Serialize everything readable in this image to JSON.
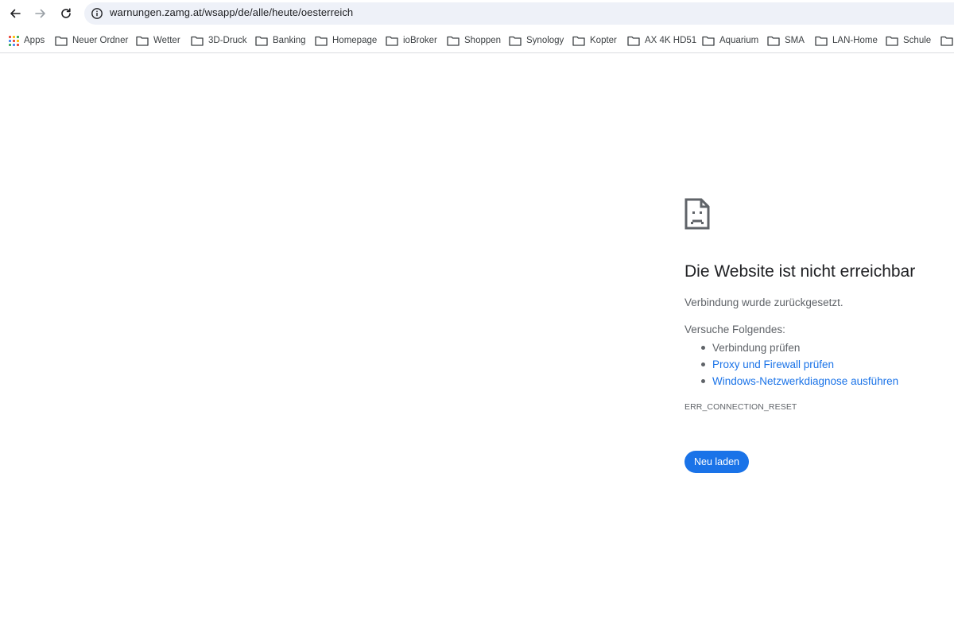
{
  "toolbar": {
    "url": "warnungen.zamg.at/wsapp/de/alle/heute/oesterreich",
    "icons": [
      "back-icon",
      "forward-icon",
      "reload-icon",
      "site-info-icon"
    ]
  },
  "bookmarks": {
    "apps_label": "Apps",
    "items": [
      {
        "label": "Neuer Ordner"
      },
      {
        "label": "Wetter"
      },
      {
        "label": "3D-Druck"
      },
      {
        "label": "Banking"
      },
      {
        "label": "Homepage"
      },
      {
        "label": "ioBroker"
      },
      {
        "label": "Shoppen"
      },
      {
        "label": "Synology"
      },
      {
        "label": "Kopter"
      },
      {
        "label": "AX 4K HD51"
      },
      {
        "label": "Aquarium"
      },
      {
        "label": "SMA"
      },
      {
        "label": "LAN-Home"
      },
      {
        "label": "Schule"
      }
    ]
  },
  "error": {
    "icon": "sad-page-icon",
    "headline": "Die Website ist nicht erreichbar",
    "subtext": "Verbindung wurde zurückgesetzt.",
    "try_label": "Versuche Folgendes:",
    "suggestions": [
      {
        "label": "Verbindung prüfen",
        "link": false
      },
      {
        "label": "Proxy und Firewall prüfen",
        "link": true
      },
      {
        "label": "Windows-Netzwerkdiagnose ausführen",
        "link": true
      }
    ],
    "code": "ERR_CONNECTION_RESET",
    "reload_label": "Neu laden"
  },
  "colors": {
    "accent": "#1a73e8",
    "omnibox_bg": "#eef1f8",
    "text_secondary": "#5f6368"
  }
}
